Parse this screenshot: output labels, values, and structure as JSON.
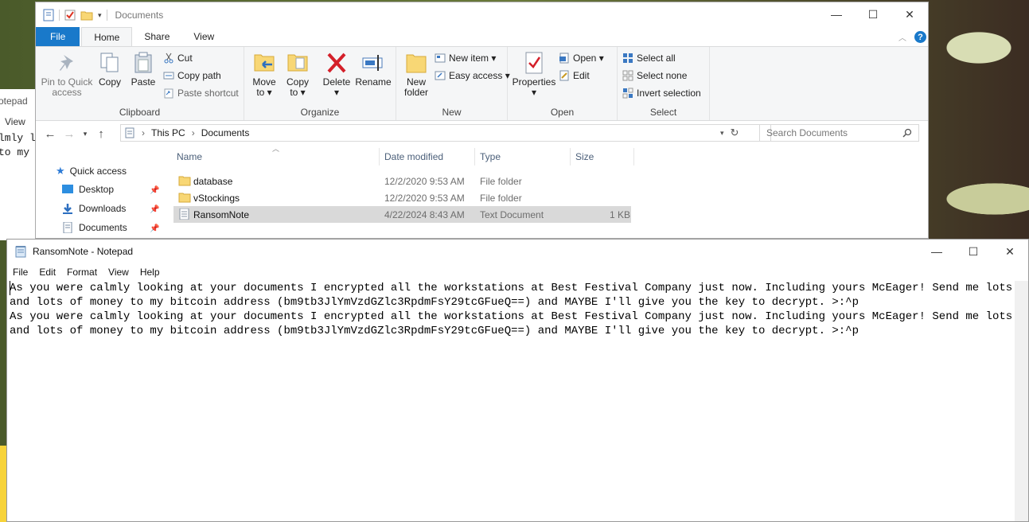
{
  "background": {
    "partial_notepad": {
      "title_fragment": "otepad",
      "menu_fragment": "View",
      "line1_fragment": "lmly l",
      "line2_fragment": "to my"
    }
  },
  "explorer": {
    "title": "Documents",
    "window_buttons": {
      "minimize": "—",
      "maximize": "☐",
      "close": "✕"
    },
    "tabs": [
      {
        "label": "File"
      },
      {
        "label": "Home"
      },
      {
        "label": "Share"
      },
      {
        "label": "View"
      }
    ],
    "ribbon": {
      "clipboard": {
        "label": "Clipboard",
        "pin_label_1": "Pin to Quick",
        "pin_label_2": "access",
        "copy": "Copy",
        "paste": "Paste",
        "cut": "Cut",
        "copy_path": "Copy path",
        "paste_shortcut": "Paste shortcut"
      },
      "organize": {
        "label": "Organize",
        "move_to_1": "Move",
        "move_to_2": "to ▾",
        "copy_to_1": "Copy",
        "copy_to_2": "to ▾",
        "delete": "Delete",
        "delete_arrow": "▾",
        "rename": "Rename"
      },
      "new": {
        "label": "New",
        "new_folder_1": "New",
        "new_folder_2": "folder",
        "new_item": "New item ▾",
        "easy_access": "Easy access ▾"
      },
      "open": {
        "label": "Open",
        "properties": "Properties",
        "properties_arrow": "▾",
        "open": "Open ▾",
        "edit": "Edit"
      },
      "select": {
        "label": "Select",
        "select_all": "Select all",
        "select_none": "Select none",
        "invert_selection": "Invert selection"
      }
    },
    "address": {
      "crumb_this_pc": "This PC",
      "crumb_documents": "Documents",
      "separator": "›",
      "search_placeholder": "Search Documents"
    },
    "nav_pane": {
      "quick_access": "Quick access",
      "items": [
        {
          "label": "Desktop"
        },
        {
          "label": "Downloads"
        },
        {
          "label": "Documents"
        }
      ]
    },
    "file_list": {
      "columns": {
        "name": "Name",
        "date": "Date modified",
        "type": "Type",
        "size": "Size"
      },
      "rows": [
        {
          "name": "database",
          "date": "12/2/2020 9:53 AM",
          "type": "File folder",
          "size": "",
          "kind": "folder"
        },
        {
          "name": "vStockings",
          "date": "12/2/2020 9:53 AM",
          "type": "File folder",
          "size": "",
          "kind": "folder"
        },
        {
          "name": "RansomNote",
          "date": "4/22/2024 8:43 AM",
          "type": "Text Document",
          "size": "1 KB",
          "kind": "text",
          "selected": true
        }
      ]
    }
  },
  "notepad": {
    "title": "RansomNote - Notepad",
    "menu": [
      "File",
      "Edit",
      "Format",
      "View",
      "Help"
    ],
    "content": "As you were calmly looking at your documents I encrypted all the workstations at Best Festival Company just now. Including yours McEager! Send me lots and lots of money to my bitcoin address (bm9tb3JlYmVzdGZlc3RpdmFsY29tcGFueQ==) and MAYBE I'll give you the key to decrypt. >:^p\nAs you were calmly looking at your documents I encrypted all the workstations at Best Festival Company just now. Including yours McEager! Send me lots and lots of money to my bitcoin address (bm9tb3JlYmVzdGZlc3RpdmFsY29tcGFueQ==) and MAYBE I'll give you the key to decrypt. >:^p"
  }
}
